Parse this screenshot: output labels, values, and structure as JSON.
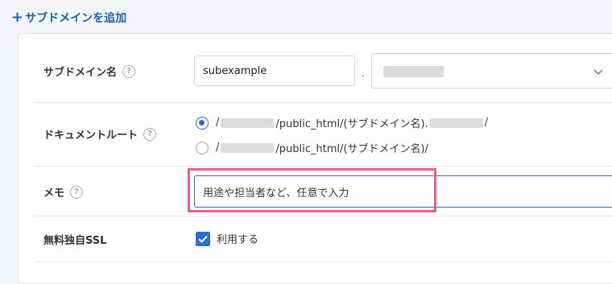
{
  "add_subdomain_label": "サブドメインを追加",
  "rows": {
    "subdomain": {
      "label": "サブドメイン名",
      "input_value": "subexample",
      "separator": "."
    },
    "document_root": {
      "label": "ドキュメントルート",
      "options": [
        {
          "prefix": "/",
          "middle": "/public_html/(サブドメイン名).",
          "suffix": "/",
          "checked": true
        },
        {
          "prefix": "/",
          "middle": "/public_html/(サブドメイン名)/",
          "suffix": "",
          "checked": false
        }
      ]
    },
    "memo": {
      "label": "メモ",
      "placeholder": "用途や担当者など、任意で入力"
    },
    "ssl": {
      "label": "無料独自SSL",
      "checkbox_label": "利用する",
      "checked": true
    }
  },
  "colors": {
    "accent": "#2a6dd5",
    "link": "#1f5fb5",
    "highlight": "#e85d9b"
  }
}
